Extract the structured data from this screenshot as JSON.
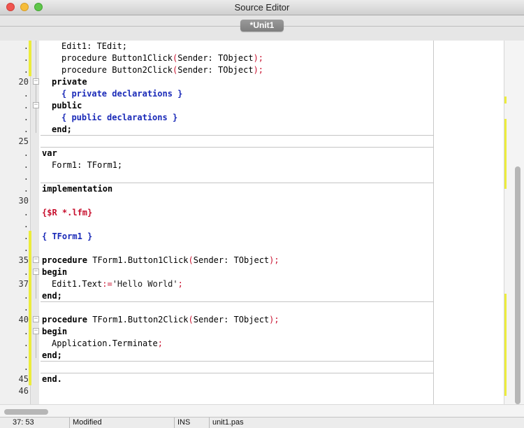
{
  "window": {
    "title": "Source Editor"
  },
  "tabs": [
    {
      "label": "*Unit1"
    }
  ],
  "line_numbers": [
    ".",
    ".",
    ".",
    "20",
    ".",
    ".",
    ".",
    ".",
    "25",
    ".",
    ".",
    ".",
    ".",
    "30",
    ".",
    ".",
    ".",
    ".",
    "35",
    ".",
    "37",
    ".",
    ".",
    "40",
    ".",
    ".",
    ".",
    ".",
    "45",
    "46"
  ],
  "code": {
    "l1": "Edit1: TEdit;",
    "l2_proc": "procedure",
    "l2_name": "Button1Click",
    "l2_args": "Sender: TObject",
    "l3_proc": "procedure",
    "l3_name": "Button2Click",
    "l3_args": "Sender: TObject",
    "l4": "private",
    "l5": "{ private declarations }",
    "l6": "public",
    "l7": "{ public declarations }",
    "l8": "end;",
    "l10": "var",
    "l11": "Form1: TForm1;",
    "l13": "implementation",
    "l15": "{$R *.lfm}",
    "l17": "{ TForm1 }",
    "l19_proc": "procedure",
    "l19_name": "TForm1.Button1Click",
    "l19_args": "Sender: TObject",
    "l20": "begin",
    "l21_a": "Edit1.Text",
    "l21_b": "'Hello World'",
    "l22": "end;",
    "l24_proc": "procedure",
    "l24_name": "TForm1.Button2Click",
    "l24_args": "Sender: TObject",
    "l25": "begin",
    "l26": "Application.Terminate",
    "l27": "end;",
    "l29": "end."
  },
  "status": {
    "position": "37: 53",
    "modified": "Modified",
    "mode": "INS",
    "file": "unit1.pas"
  },
  "colors": {
    "modified_marker": "#ecec3c",
    "comment": "#1a2ab8",
    "directive": "#c8102e"
  }
}
